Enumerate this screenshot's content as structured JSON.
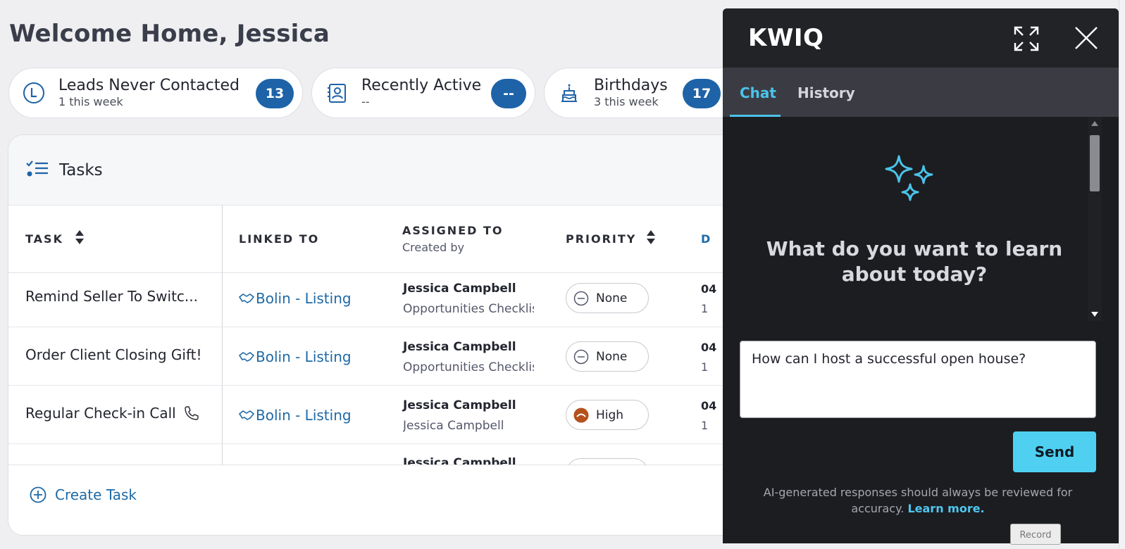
{
  "page": {
    "title": "Welcome Home, Jessica"
  },
  "stats": [
    {
      "title": "Leads Never Contacted",
      "sub": "1 this week",
      "badge": "13",
      "icon": "clock-L-icon"
    },
    {
      "title": "Recently Active",
      "sub": "--",
      "badge": "--",
      "icon": "contact-book-icon"
    },
    {
      "title": "Birthdays",
      "sub": "3 this week",
      "badge": "17",
      "icon": "cake-icon"
    }
  ],
  "tasks": {
    "title": "Tasks",
    "columns": {
      "task": "TASK",
      "linked": "LINKED TO",
      "assigned": "ASSIGNED TO",
      "created_by": "Created by",
      "priority": "PRIORITY",
      "due": "D"
    },
    "rows": [
      {
        "name": "Remind Seller To Switc...",
        "link": "Bolin - Listing",
        "assignee": "Jessica Campbell",
        "creator": "Opportunities Checklist",
        "priority": "None",
        "date1": "04",
        "date2": "1"
      },
      {
        "name": "Order Client Closing Gift!",
        "link": "Bolin - Listing",
        "assignee": "Jessica Campbell",
        "creator": "Opportunities Checklist",
        "priority": "None",
        "date1": "04",
        "date2": "1"
      },
      {
        "name": "Regular Check-in Call",
        "link": "Bolin - Listing",
        "assignee": "Jessica Campbell",
        "creator": "Jessica Campbell",
        "priority": "High",
        "date1": "04",
        "date2": "1"
      },
      {
        "name": "",
        "link": "",
        "assignee": "Jessica Campbell",
        "creator": "",
        "priority": "",
        "date1": "",
        "date2": ""
      }
    ],
    "create_label": "Create Task"
  },
  "kwiq": {
    "title": "KWIQ",
    "tabs": {
      "chat": "Chat",
      "history": "History"
    },
    "prompt": "What do you want to learn about today?",
    "input_value": "How can I host a successful open house?",
    "send_label": "Send",
    "disclaimer": "AI-generated responses should always be reviewed for accuracy.",
    "learn_more": "Learn more."
  },
  "record_label": "Record",
  "colors": {
    "accent": "#1e63a8",
    "link": "#1e69a6",
    "kwiq_accent": "#4bc3ea",
    "send": "#4fd0f1",
    "priority_high": "#b5511c"
  }
}
